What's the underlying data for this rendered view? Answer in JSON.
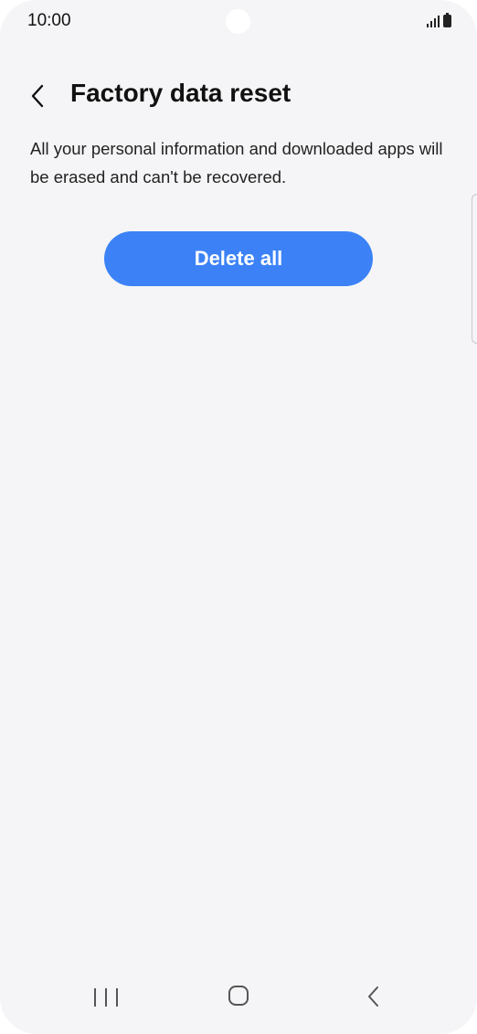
{
  "status_bar": {
    "time": "10:00",
    "icons": [
      "signal-icon",
      "battery-icon"
    ]
  },
  "header": {
    "back_icon": "chevron-left-icon",
    "title": "Factory data reset"
  },
  "main": {
    "description": "All your personal information and downloaded apps will be erased and can't be recovered.",
    "delete_button_label": "Delete all"
  },
  "nav_bar": {
    "icons": [
      "recents-icon",
      "home-icon",
      "back-icon"
    ]
  },
  "colors": {
    "background": "#f5f5f7",
    "accent": "#3c82f6",
    "button_text": "#ffffff"
  }
}
